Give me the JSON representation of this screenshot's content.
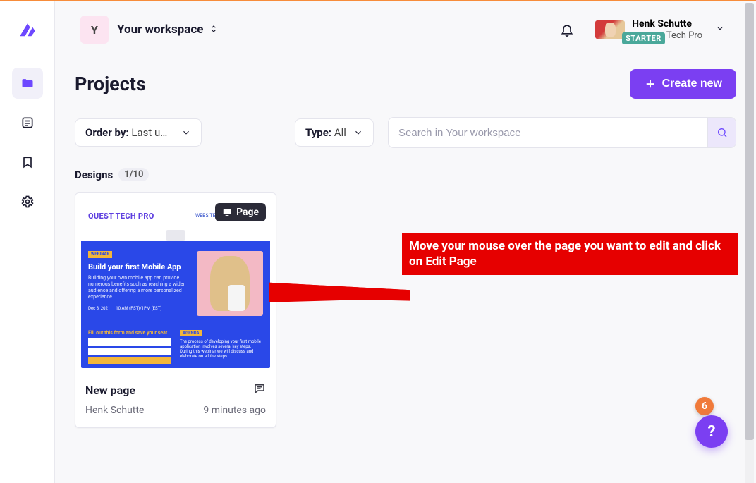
{
  "workspace": {
    "initial": "Y",
    "name": "Your workspace"
  },
  "user": {
    "name": "Henk Schutte",
    "plan_badge": "STARTER",
    "subtitle": "est Tech Pro"
  },
  "page": {
    "title": "Projects",
    "create_label": "Create new"
  },
  "filters": {
    "order_label": "Order by:",
    "order_value": "Last u…",
    "type_label": "Type:",
    "type_value": "All",
    "search_placeholder": "Search in Your workspace"
  },
  "designs": {
    "label": "Designs",
    "count": "1/10"
  },
  "card": {
    "tag": "Page",
    "title": "New page",
    "author": "Henk Schutte",
    "time": "9 minutes ago",
    "thumb": {
      "brand": "QUEST TECH PRO",
      "nav": "WEBSITE | WEBINARS | ABOUT",
      "badge": "WEBINAR",
      "title": "Build your first Mobile App",
      "sub": "Building your own mobile app can provide numerous benefits such as reaching a wider audience and offering a more personalized experience.",
      "date": "Dec 3, 2021",
      "time": "10 AM (PST)/1PM (EST)",
      "form_title": "Fill out this form and save your seat",
      "agenda": "AGENDA",
      "agenda_text": "The process of developing your first mobile application involves several key steps. During this webinar we will discuss and elaborate on all the steps."
    }
  },
  "callout": {
    "text": "Move your mouse over the page you want to edit and click on Edit Page"
  },
  "notifications": {
    "count": "6"
  },
  "help": {
    "label": "?"
  }
}
